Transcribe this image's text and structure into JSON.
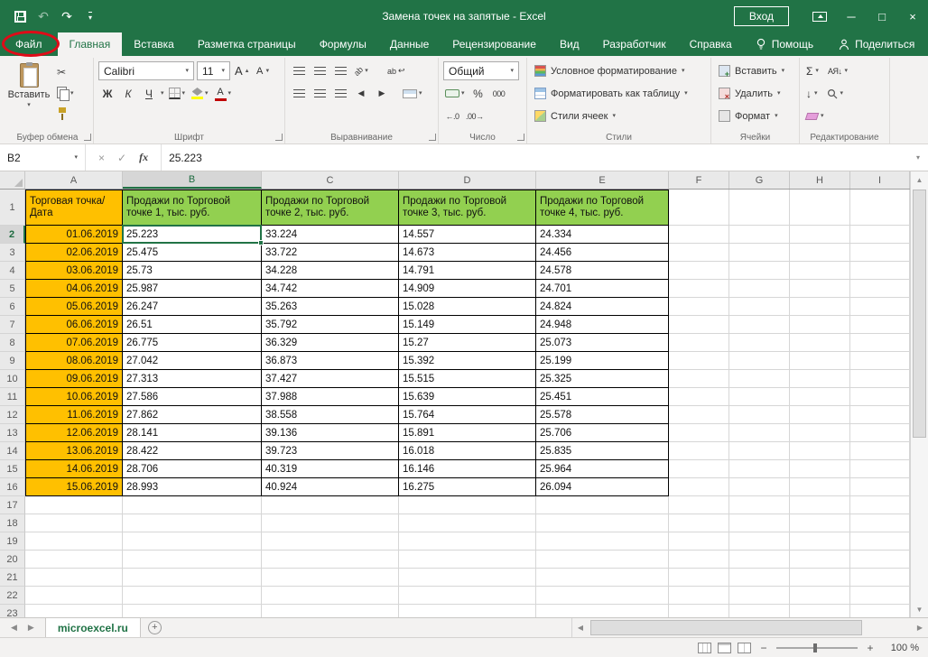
{
  "colors": {
    "excel_green": "#217346",
    "header_fill_green": "#92D050",
    "date_fill_orange": "#FFC000",
    "annotation_red": "#E00B18",
    "ribbon_bg": "#F3F2F1"
  },
  "icons": {
    "dropdown": "▾",
    "undo": "↶",
    "redo": "↷",
    "cut": "✂",
    "check": "✓",
    "cancel": "×",
    "fx": "fx",
    "sum": "Σ",
    "fill_down": "↓",
    "sort": "АЯ↓",
    "wrap_return": "↩",
    "up_arrow": "▲",
    "down_arrow": "▼",
    "left_arrow": "◀",
    "right_arrow": "▶",
    "plus": "+",
    "minus": "−",
    "minimize": "─",
    "maximize": "□",
    "close": "×",
    "decimal_increase": "←.0",
    "decimal_decrease": ".00→",
    "orientation_letters": "ab",
    "grow_letter": "А"
  },
  "titlebar": {
    "title": "Замена точек на запятые  -  Excel",
    "login_button": "Вход"
  },
  "tabs": {
    "file": "Файл",
    "main": [
      "Главная",
      "Вставка",
      "Разметка страницы",
      "Формулы",
      "Данные",
      "Рецензирование",
      "Вид",
      "Разработчик",
      "Справка"
    ],
    "active": "Главная",
    "help": "Помощь",
    "share": "Поделиться"
  },
  "ribbon": {
    "clipboard": {
      "label": "Буфер обмена",
      "paste": "Вставить"
    },
    "font": {
      "label": "Шрифт",
      "name": "Calibri",
      "size": "11",
      "bold": "Ж",
      "italic": "К",
      "underline": "Ч"
    },
    "alignment": {
      "label": "Выравнивание",
      "wrap": "ab"
    },
    "number": {
      "label": "Число",
      "format": "Общий",
      "percent": "%",
      "thousands": "000"
    },
    "styles": {
      "label": "Стили",
      "conditional": "Условное форматирование",
      "format_as_table": "Форматировать как таблицу",
      "cell_styles": "Стили ячеек"
    },
    "cells": {
      "label": "Ячейки",
      "insert": "Вставить",
      "delete": "Удалить",
      "format": "Формат"
    },
    "editing": {
      "label": "Редактирование"
    }
  },
  "formula_bar": {
    "name_box": "B2",
    "value": "25.223"
  },
  "grid": {
    "selected_cell": "B2",
    "col_headers": [
      "A",
      "B",
      "C",
      "D",
      "E",
      "F",
      "G",
      "H",
      "I"
    ],
    "selected_col": "B",
    "selected_row": 2,
    "num_rows": 22,
    "header_row": [
      "Торговая точка/\nДата",
      "Продажи по Торговой точке 1, тыс. руб.",
      "Продажи по Торговой точке 2, тыс. руб.",
      "Продажи по Торговой точке 3, тыс. руб.",
      "Продажи по Торговой точке 4, тыс. руб."
    ],
    "data_rows": [
      [
        "01.06.2019",
        "25.223",
        "33.224",
        "14.557",
        "24.334"
      ],
      [
        "02.06.2019",
        "25.475",
        "33.722",
        "14.673",
        "24.456"
      ],
      [
        "03.06.2019",
        "25.73",
        "34.228",
        "14.791",
        "24.578"
      ],
      [
        "04.06.2019",
        "25.987",
        "34.742",
        "14.909",
        "24.701"
      ],
      [
        "05.06.2019",
        "26.247",
        "35.263",
        "15.028",
        "24.824"
      ],
      [
        "06.06.2019",
        "26.51",
        "35.792",
        "15.149",
        "24.948"
      ],
      [
        "07.06.2019",
        "26.775",
        "36.329",
        "15.27",
        "25.073"
      ],
      [
        "08.06.2019",
        "27.042",
        "36.873",
        "15.392",
        "25.199"
      ],
      [
        "09.06.2019",
        "27.313",
        "37.427",
        "15.515",
        "25.325"
      ],
      [
        "10.06.2019",
        "27.586",
        "37.988",
        "15.639",
        "25.451"
      ],
      [
        "11.06.2019",
        "27.862",
        "38.558",
        "15.764",
        "25.578"
      ],
      [
        "12.06.2019",
        "28.141",
        "39.136",
        "15.891",
        "25.706"
      ],
      [
        "13.06.2019",
        "28.422",
        "39.723",
        "16.018",
        "25.835"
      ],
      [
        "14.06.2019",
        "28.706",
        "40.319",
        "16.146",
        "25.964"
      ],
      [
        "15.06.2019",
        "28.993",
        "40.924",
        "16.275",
        "26.094"
      ]
    ]
  },
  "sheet_bar": {
    "tab": "microexcel.ru"
  },
  "status_bar": {
    "zoom": "100 %"
  }
}
